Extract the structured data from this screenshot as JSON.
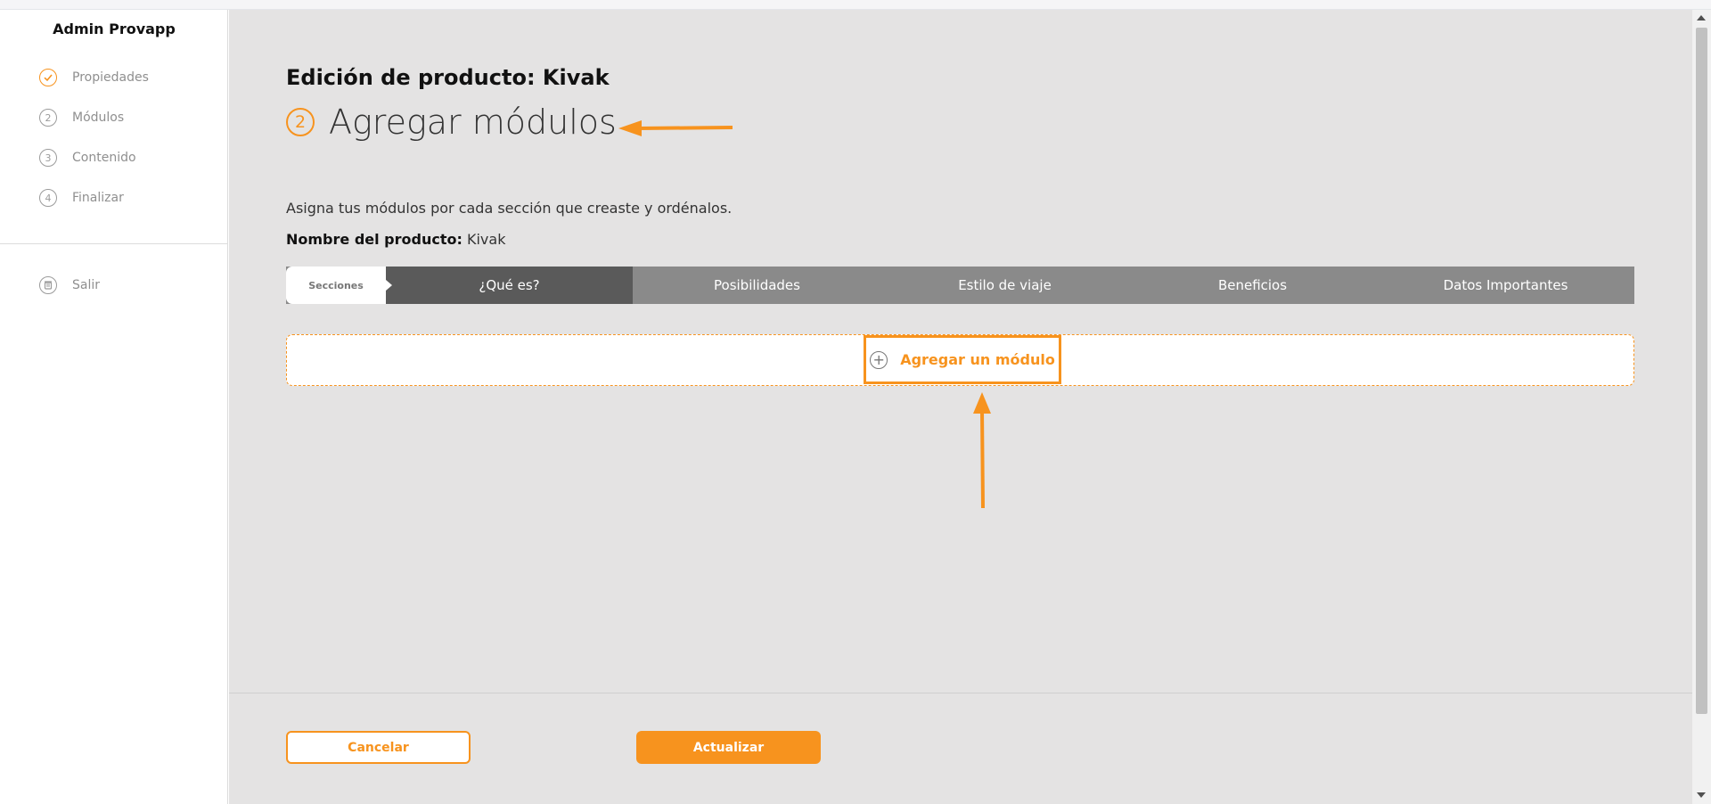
{
  "app": {
    "brand": "Admin Provapp"
  },
  "sidebar": {
    "items": [
      {
        "number": "✓",
        "label": "Propiedades",
        "state": "done"
      },
      {
        "number": "2",
        "label": "Módulos",
        "state": "pending"
      },
      {
        "number": "3",
        "label": "Contenido",
        "state": "pending"
      },
      {
        "number": "4",
        "label": "Finalizar",
        "state": "pending"
      }
    ],
    "logout_label": "Salir"
  },
  "main": {
    "page_title": "Edición de producto: Kivak",
    "step_number": "2",
    "step_title": "Agregar módulos",
    "description": "Asigna tus módulos por cada sección que creaste y ordénalos.",
    "product_name_label": "Nombre del producto:",
    "product_name_value": "Kivak",
    "sections_label": "Secciones",
    "tabs": [
      {
        "label": "¿Qué es?",
        "active": true
      },
      {
        "label": "Posibilidades",
        "active": false
      },
      {
        "label": "Estilo de viaje",
        "active": false
      },
      {
        "label": "Beneficios",
        "active": false
      },
      {
        "label": "Datos Importantes",
        "active": false
      }
    ],
    "add_module_label": "Agregar un módulo"
  },
  "footer": {
    "cancel_label": "Cancelar",
    "update_label": "Actualizar"
  },
  "colors": {
    "accent": "#f7931e",
    "tab_bar": "#8a8a8a",
    "tab_active": "#5a5a5a",
    "main_bg": "#e4e3e3"
  }
}
